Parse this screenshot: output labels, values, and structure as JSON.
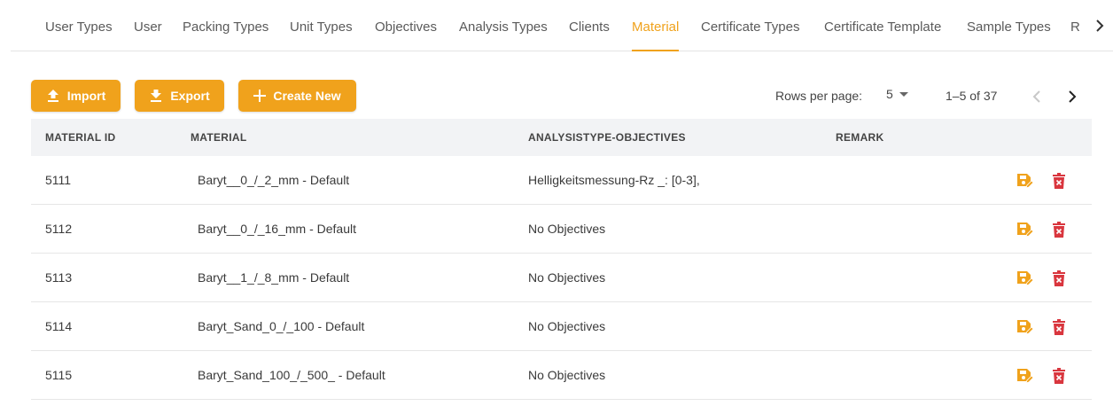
{
  "tabs": {
    "items": [
      {
        "label": "User Types"
      },
      {
        "label": "User"
      },
      {
        "label": "Packing Types"
      },
      {
        "label": "Unit Types"
      },
      {
        "label": "Objectives"
      },
      {
        "label": "Analysis Types"
      },
      {
        "label": "Clients"
      },
      {
        "label": "Material"
      },
      {
        "label": "Certificate Types"
      },
      {
        "label": "Certificate Template"
      },
      {
        "label": "Sample Types"
      },
      {
        "label": "R"
      }
    ],
    "active": "Material",
    "scroll_icon": "chevron-right-icon"
  },
  "toolbar": {
    "import_label": "Import",
    "export_label": "Export",
    "create_label": "Create New"
  },
  "pagination": {
    "rows_label": "Rows per page:",
    "rows_value": "5",
    "range": "1–5 of 37"
  },
  "table": {
    "headers": [
      "MATERIAL ID",
      "MATERIAL",
      "ANALYSISTYPE-OBJECTIVES",
      "REMARK"
    ],
    "rows": [
      {
        "id": "5111",
        "material": "Baryt__0_/_2_mm - Default",
        "objectives": "Helligkeitsmessung-Rz _: [0-3],",
        "remark": ""
      },
      {
        "id": "5112",
        "material": "Baryt__0_/_16_mm - Default",
        "objectives": "No Objectives",
        "remark": ""
      },
      {
        "id": "5113",
        "material": "Baryt__1_/_8_mm - Default",
        "objectives": "No Objectives",
        "remark": ""
      },
      {
        "id": "5114",
        "material": "Baryt_Sand_0_/_100 - Default",
        "objectives": "No Objectives",
        "remark": ""
      },
      {
        "id": "5115",
        "material": "Baryt_Sand_100_/_500_ - Default",
        "objectives": "No Objectives",
        "remark": ""
      }
    ]
  },
  "colors": {
    "accent": "#f0a21c",
    "delete": "#d9363e",
    "header_bg": "#f2f3f5"
  }
}
